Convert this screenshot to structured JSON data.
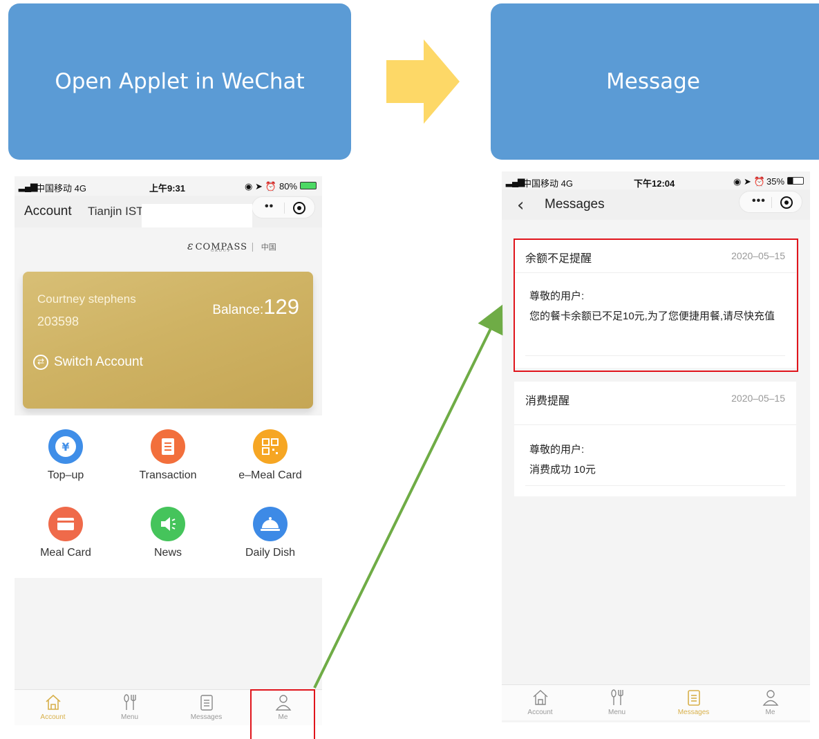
{
  "banners": {
    "left": "Open Applet in WeChat",
    "right": "Message"
  },
  "left_phone": {
    "status": {
      "carrier": "中国移动 4G",
      "time": "上午9:31",
      "battery": "80%"
    },
    "header": {
      "title": "Account",
      "tenant": "Tianjin IST"
    },
    "logo": {
      "brand": "COMPASS",
      "region": "中国",
      "group": "GROUP"
    },
    "card": {
      "name": "Courtney stephens",
      "number": "203598",
      "balance_label": "Balance:",
      "balance_value": "129",
      "switch_label": "Switch Account"
    },
    "features": [
      {
        "label": "Top–up",
        "icon": "yen-coin-icon",
        "color": "#3f8ee8"
      },
      {
        "label": "Transaction",
        "icon": "clipboard-icon",
        "color": "#f26f3c"
      },
      {
        "label": "e–Meal Card",
        "icon": "qr-code-icon",
        "color": "#f6a623"
      },
      {
        "label": "Meal Card",
        "icon": "card-icon",
        "color": "#ef6a4a"
      },
      {
        "label": "News",
        "icon": "speaker-icon",
        "color": "#45c45b"
      },
      {
        "label": "Daily Dish",
        "icon": "cloche-icon",
        "color": "#3d8ae6"
      }
    ],
    "tabs": [
      {
        "label": "Account",
        "icon": "home-icon",
        "active": true
      },
      {
        "label": "Menu",
        "icon": "cutlery-icon",
        "active": false
      },
      {
        "label": "Messages",
        "icon": "document-icon",
        "active": false
      },
      {
        "label": "Me",
        "icon": "person-icon",
        "active": false
      }
    ]
  },
  "right_phone": {
    "status": {
      "carrier": "中国移动 4G",
      "time": "下午12:04",
      "battery": "35%"
    },
    "header": {
      "title": "Messages"
    },
    "messages": [
      {
        "title": "余额不足提醒",
        "date": "2020–05–15",
        "greeting": "尊敬的用户:",
        "body": "您的餐卡余额已不足10元,为了您便捷用餐,请尽快充值"
      },
      {
        "title": "消费提醒",
        "date": "2020–05–15",
        "greeting": "尊敬的用户:",
        "body": "消费成功 10元"
      }
    ],
    "tabs": [
      {
        "label": "Account",
        "icon": "home-icon",
        "active": false
      },
      {
        "label": "Menu",
        "icon": "cutlery-icon",
        "active": false
      },
      {
        "label": "Messages",
        "icon": "document-icon",
        "active": true
      },
      {
        "label": "Me",
        "icon": "person-icon",
        "active": false
      }
    ]
  },
  "colors": {
    "banner": "#5b9bd5",
    "arrow": "#fdd867",
    "highlight": "#e0141b",
    "connector": "#6fac46",
    "card_gold": "#cfb364",
    "tab_active": "#d8b04a"
  }
}
